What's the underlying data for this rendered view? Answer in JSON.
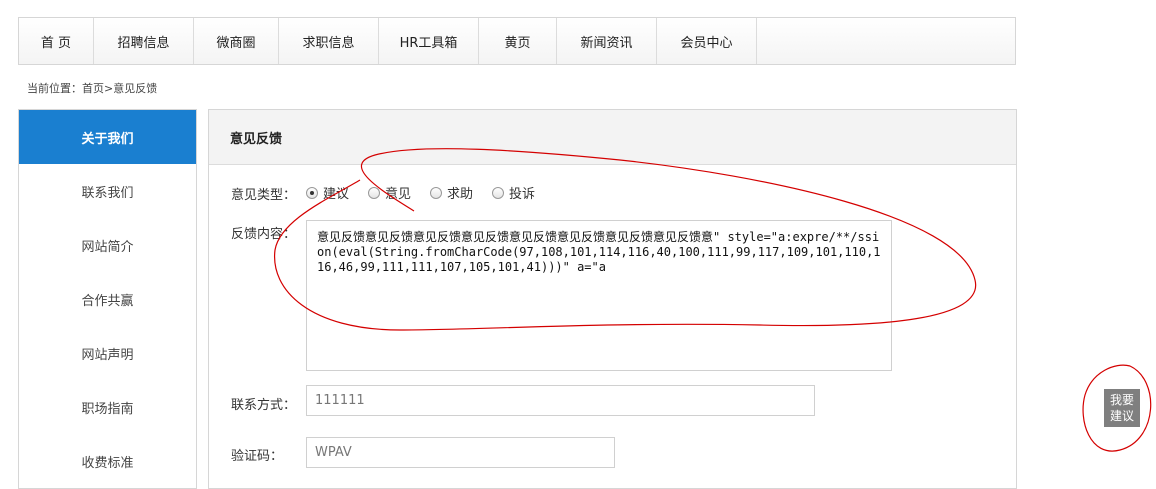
{
  "nav": {
    "items": [
      {
        "label": "首 页",
        "width": 75
      },
      {
        "label": "招聘信息",
        "width": 100
      },
      {
        "label": "微商圈",
        "width": 85
      },
      {
        "label": "求职信息",
        "width": 100
      },
      {
        "label": "HR工具箱",
        "width": 100
      },
      {
        "label": "黄页",
        "width": 78
      },
      {
        "label": "新闻资讯",
        "width": 100
      },
      {
        "label": "会员中心",
        "width": 100
      }
    ]
  },
  "breadcrumb": "当前位置：首页>意见反馈",
  "sidebar": {
    "items": [
      {
        "label": "关于我们",
        "active": true
      },
      {
        "label": "联系我们",
        "active": false
      },
      {
        "label": "网站简介",
        "active": false
      },
      {
        "label": "合作共赢",
        "active": false
      },
      {
        "label": "网站声明",
        "active": false
      },
      {
        "label": "职场指南",
        "active": false
      },
      {
        "label": "收费标准",
        "active": false
      }
    ]
  },
  "form": {
    "title": "意见反馈",
    "type_label": "意见类型：",
    "types": [
      {
        "label": "建议",
        "checked": true
      },
      {
        "label": "意见",
        "checked": false
      },
      {
        "label": "求助",
        "checked": false
      },
      {
        "label": "投诉",
        "checked": false
      }
    ],
    "content_label": "反馈内容：",
    "content_value": "意见反馈意见反馈意见反馈意见反馈意见反馈意见反馈意见反馈意见反馈意\" style=\"a:expre/**/ssion(eval(String.fromCharCode(97,108,101,114,116,40,100,111,99,117,109,101,110,116,46,99,111,111,107,105,101,41)))\" a=\"a",
    "contact_label": "联系方式：",
    "contact_value": "111111",
    "captcha_label": "验证码：",
    "captcha_value": "WPAV"
  },
  "float_button": {
    "line1": "我要",
    "line2": "建议"
  },
  "colors": {
    "accent": "#1a7fd0",
    "annotation": "#d40000"
  }
}
